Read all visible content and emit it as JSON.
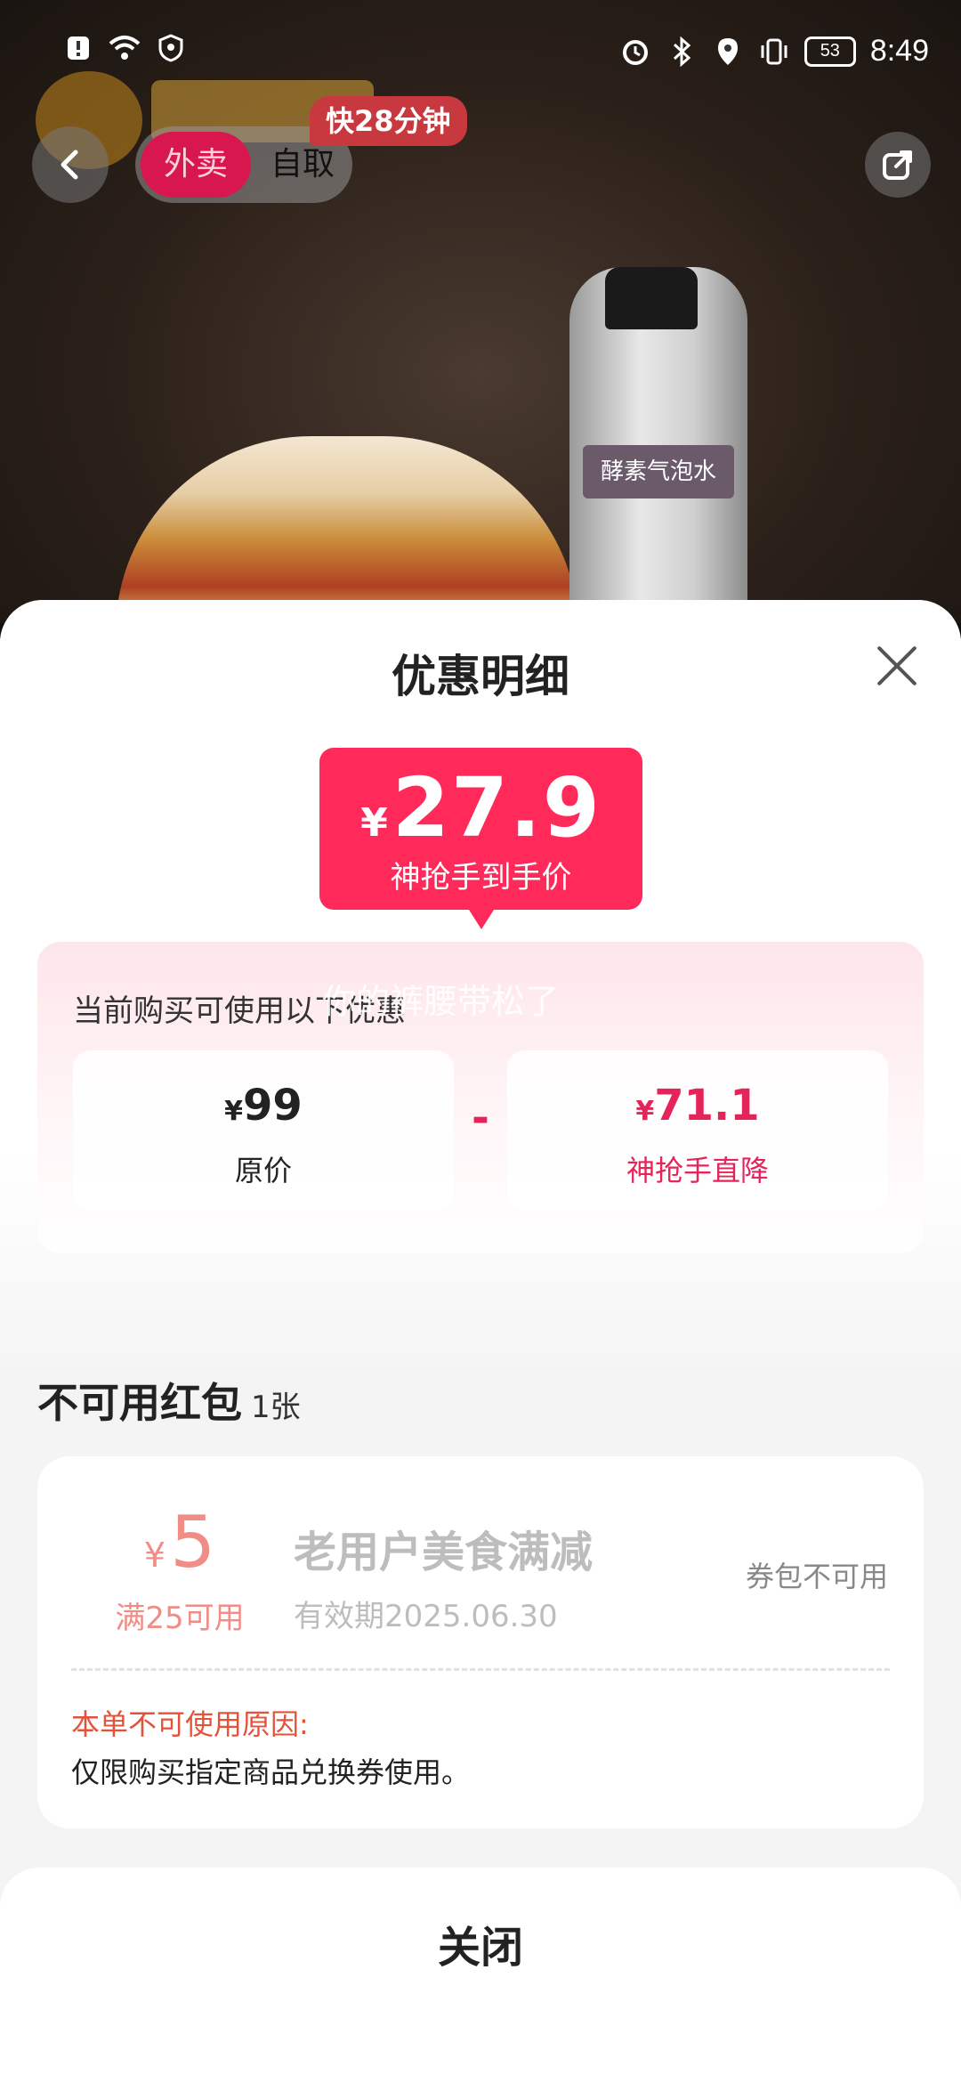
{
  "status_bar": {
    "time": "8:49",
    "battery": "53",
    "left_icons": [
      "notification-icon",
      "wifi-icon",
      "shield-icon"
    ],
    "right_icons": [
      "alarm-icon",
      "bluetooth-icon",
      "location-icon",
      "vibrate-icon"
    ]
  },
  "header": {
    "mode_active": "外卖",
    "mode_inactive": "自取",
    "eta_badge": "快28分钟",
    "bottle_label": "酵素气泡水"
  },
  "sheet": {
    "title": "优惠明细",
    "final_price": {
      "currency": "¥",
      "value": "27.9",
      "label": "神抢手到手价"
    },
    "discount_heading": "当前购买可使用以下优惠",
    "watermark": "你的裤腰带松了",
    "original": {
      "currency": "¥",
      "value": "99",
      "label": "原价"
    },
    "operator": "-",
    "reduction": {
      "currency": "¥",
      "value": "71.1",
      "label": "神抢手直降"
    }
  },
  "unavailable": {
    "title": "不可用红包",
    "count": "1张",
    "coupons": [
      {
        "currency": "¥",
        "amount": "5",
        "condition": "满25可用",
        "name": "老用户美食满减",
        "expiry": "有效期2025.06.30",
        "status": "券包不可用",
        "reason_label": "本单不可使用原因:",
        "reason_text": "仅限购买指定商品兑换券使用。"
      }
    ]
  },
  "footer": {
    "close_label": "关闭"
  },
  "colors": {
    "accent": "#ff2a5a",
    "discount_text": "#e5245a",
    "coupon_amount": "#f08d86",
    "reason_label": "#e5523a"
  }
}
